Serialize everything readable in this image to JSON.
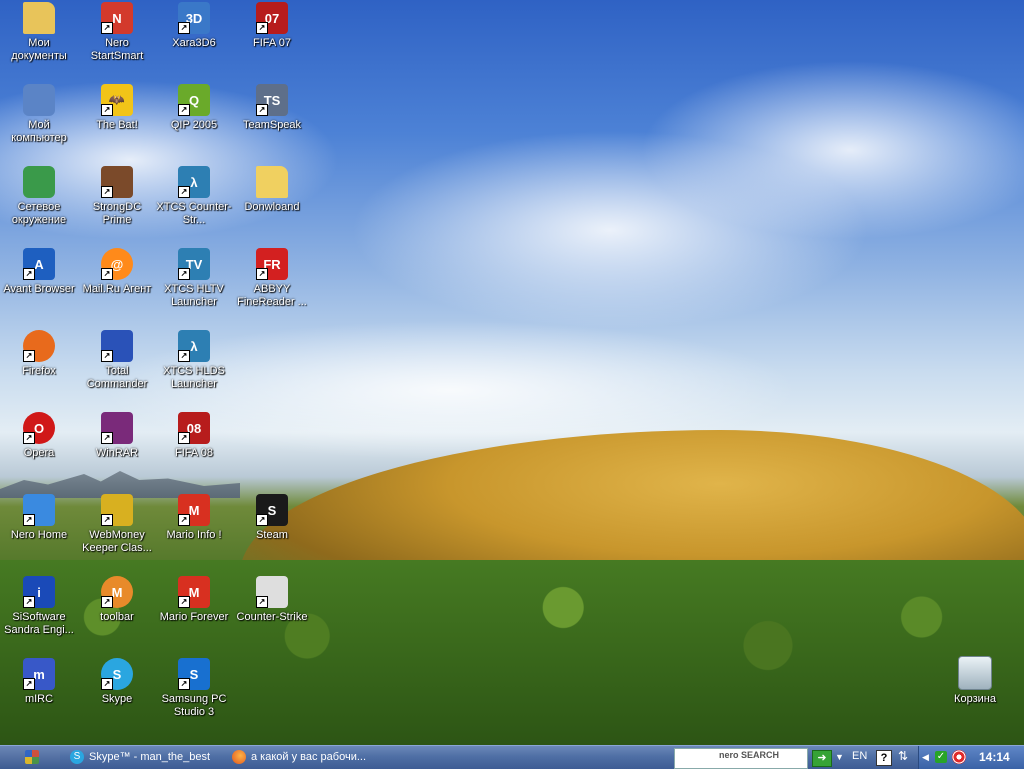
{
  "desktop": {
    "icons": [
      {
        "label": "Мои документы",
        "icon": "folder-icon",
        "color": "#e8c45a",
        "glyph": ""
      },
      {
        "label": "Nero StartSmart",
        "icon": "nero-icon",
        "color": "#d33a2c",
        "glyph": "N"
      },
      {
        "label": "Xara3D6",
        "icon": "xara-3d-icon",
        "color": "#3a78c8",
        "glyph": "3D"
      },
      {
        "label": "FIFA 07",
        "icon": "fifa-icon",
        "color": "#b71c1c",
        "glyph": "07"
      },
      {
        "label": "Мой компьютер",
        "icon": "computer-icon",
        "color": "#5b84c6",
        "glyph": ""
      },
      {
        "label": "The Bat!",
        "icon": "bat-icon",
        "color": "#f2c418",
        "glyph": "🦇"
      },
      {
        "label": "QIP 2005",
        "icon": "qip-icon",
        "color": "#6aaa2a",
        "glyph": "Q"
      },
      {
        "label": "TeamSpeak",
        "icon": "teamspeak-icon",
        "color": "#5e6f8a",
        "glyph": "TS"
      },
      {
        "label": "Сетевое окружение",
        "icon": "network-icon",
        "color": "#3a9a4a",
        "glyph": ""
      },
      {
        "label": "StrongDC Prime",
        "icon": "strongdc-icon",
        "color": "#7b4a2a",
        "glyph": ""
      },
      {
        "label": "XTCS Counter-Str...",
        "icon": "xtcs-icon",
        "color": "#2d7fb3",
        "glyph": "λ"
      },
      {
        "label": "Donwloand",
        "icon": "folder-icon",
        "color": "#f0d060",
        "glyph": ""
      },
      {
        "label": "Avant Browser",
        "icon": "avant-icon",
        "color": "#1e5fc0",
        "glyph": "A"
      },
      {
        "label": "Mail.Ru Агент",
        "icon": "mailru-icon",
        "color": "#ff8a1a",
        "glyph": "@"
      },
      {
        "label": "XTCS HLTV Launcher",
        "icon": "hltv-icon",
        "color": "#2d7fb3",
        "glyph": "TV"
      },
      {
        "label": "ABBYY FineReader ...",
        "icon": "abbyy-icon",
        "color": "#d32020",
        "glyph": "FR"
      },
      {
        "label": "Firefox",
        "icon": "firefox-icon",
        "color": "#e86a1c",
        "glyph": ""
      },
      {
        "label": "Total Commander",
        "icon": "floppy-icon",
        "color": "#2a52b8",
        "glyph": ""
      },
      {
        "label": "XTCS HLDS Launcher",
        "icon": "hlds-icon",
        "color": "#2d7fb3",
        "glyph": "λ"
      },
      {
        "label": "",
        "icon": "",
        "color": "",
        "glyph": ""
      },
      {
        "label": "Opera",
        "icon": "opera-icon",
        "color": "#d01818",
        "glyph": "O"
      },
      {
        "label": "WinRAR",
        "icon": "winrar-icon",
        "color": "#7a2a7a",
        "glyph": ""
      },
      {
        "label": "FIFA 08",
        "icon": "fifa-icon",
        "color": "#b71c1c",
        "glyph": "08"
      },
      {
        "label": "",
        "icon": "",
        "color": "",
        "glyph": ""
      },
      {
        "label": "Nero Home",
        "icon": "nero-home-icon",
        "color": "#3a8ae0",
        "glyph": ""
      },
      {
        "label": "WebMoney Keeper Clas...",
        "icon": "webmoney-icon",
        "color": "#d8b020",
        "glyph": ""
      },
      {
        "label": "Mario Info !",
        "icon": "mario-icon",
        "color": "#d83020",
        "glyph": "M"
      },
      {
        "label": "Steam",
        "icon": "steam-icon",
        "color": "#1a1a1a",
        "glyph": "S"
      },
      {
        "label": "SiSoftware Sandra Engi...",
        "icon": "sandra-icon",
        "color": "#1a4ab8",
        "glyph": "i"
      },
      {
        "label": "toolbar",
        "icon": "toolbar-icon",
        "color": "#e88a2a",
        "glyph": "M"
      },
      {
        "label": "Mario Forever",
        "icon": "mario-icon",
        "color": "#d83020",
        "glyph": "M"
      },
      {
        "label": "Counter-Strike",
        "icon": "counter-strike-icon",
        "color": "#dedede",
        "glyph": ""
      },
      {
        "label": "mIRC",
        "icon": "mirc-icon",
        "color": "#3858c8",
        "glyph": "m"
      },
      {
        "label": "Skype",
        "icon": "skype-icon",
        "color": "#2aa6e0",
        "glyph": "S"
      },
      {
        "label": "Samsung PC Studio 3",
        "icon": "samsung-icon",
        "color": "#1870d0",
        "glyph": "S"
      },
      {
        "label": "",
        "icon": "",
        "color": "",
        "glyph": ""
      }
    ],
    "recycle_bin": {
      "label": "Корзина",
      "icon": "recycle-bin-icon"
    }
  },
  "taskbar": {
    "tasks": [
      {
        "label": "Skype™ - man_the_best",
        "icon": "skype-icon"
      },
      {
        "label": "а какой у вас рабочи...",
        "icon": "firefox-icon"
      }
    ],
    "search_logo": "nero SEARCH",
    "language": "EN",
    "clock": "14:14"
  }
}
